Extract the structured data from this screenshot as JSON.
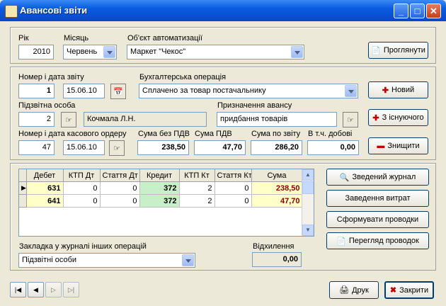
{
  "window": {
    "title": "Авансові звіти"
  },
  "period": {
    "year_label": "Рік",
    "year_value": "2010",
    "month_label": "Місяць",
    "month_value": "Червень",
    "object_label": "Об'єкт автоматизації",
    "object_value": "Маркет \"Чекос\"",
    "view_button": "Проглянути"
  },
  "report": {
    "number_date_label": "Номер і дата звіту",
    "number": "1",
    "date": "15.06.10",
    "operation_label": "Бухгалтерська операція",
    "operation_value": "Сплачено за товар постачальнику",
    "person_label": "Підзвітна особа",
    "person_code": "2",
    "person_name": "Кочмала Л.Н.",
    "purpose_label": "Призначення авансу",
    "purpose_value": "придбання товарів",
    "cash_order_label": "Номер і дата касового ордеру",
    "cash_order_number": "47",
    "cash_order_date": "15.06.10",
    "sum_no_vat_label": "Сума без ПДВ",
    "sum_no_vat": "238,50",
    "vat_label": "Сума ПДВ",
    "vat": "47,70",
    "sum_report_label": "Сума по звіту",
    "sum_report": "286,20",
    "daily_label": "В т.ч. добові",
    "daily": "0,00"
  },
  "actions": {
    "new": "Новий",
    "from_existing": "З існуючого",
    "delete": "Знищити"
  },
  "grid": {
    "columns": [
      "Дебет",
      "КТП Дт",
      "Стаття Дт",
      "Кредит",
      "КТП Кт",
      "Стаття Кт",
      "Сума"
    ],
    "rows": [
      [
        "631",
        "0",
        "0",
        "372",
        "2",
        "0",
        "238,50"
      ],
      [
        "641",
        "0",
        "0",
        "372",
        "2",
        "0",
        "47,70"
      ]
    ]
  },
  "side_buttons": {
    "journal": "Зведений журнал",
    "expenses": "Заведення витрат",
    "form_entries": "Сформувати проводки",
    "view_entries": "Перегляд проводок"
  },
  "bookmark": {
    "label": "Закладка у журналі інших операцій",
    "value": "Підзвітні особи"
  },
  "deviation": {
    "label": "Відхилення",
    "value": "0,00"
  },
  "footer": {
    "print": "Друк",
    "close": "Закрити"
  },
  "colors": {
    "sum_red": "#8b0000",
    "credit_green": "#c8f0c8",
    "debit_yellow": "#ffffc8"
  }
}
